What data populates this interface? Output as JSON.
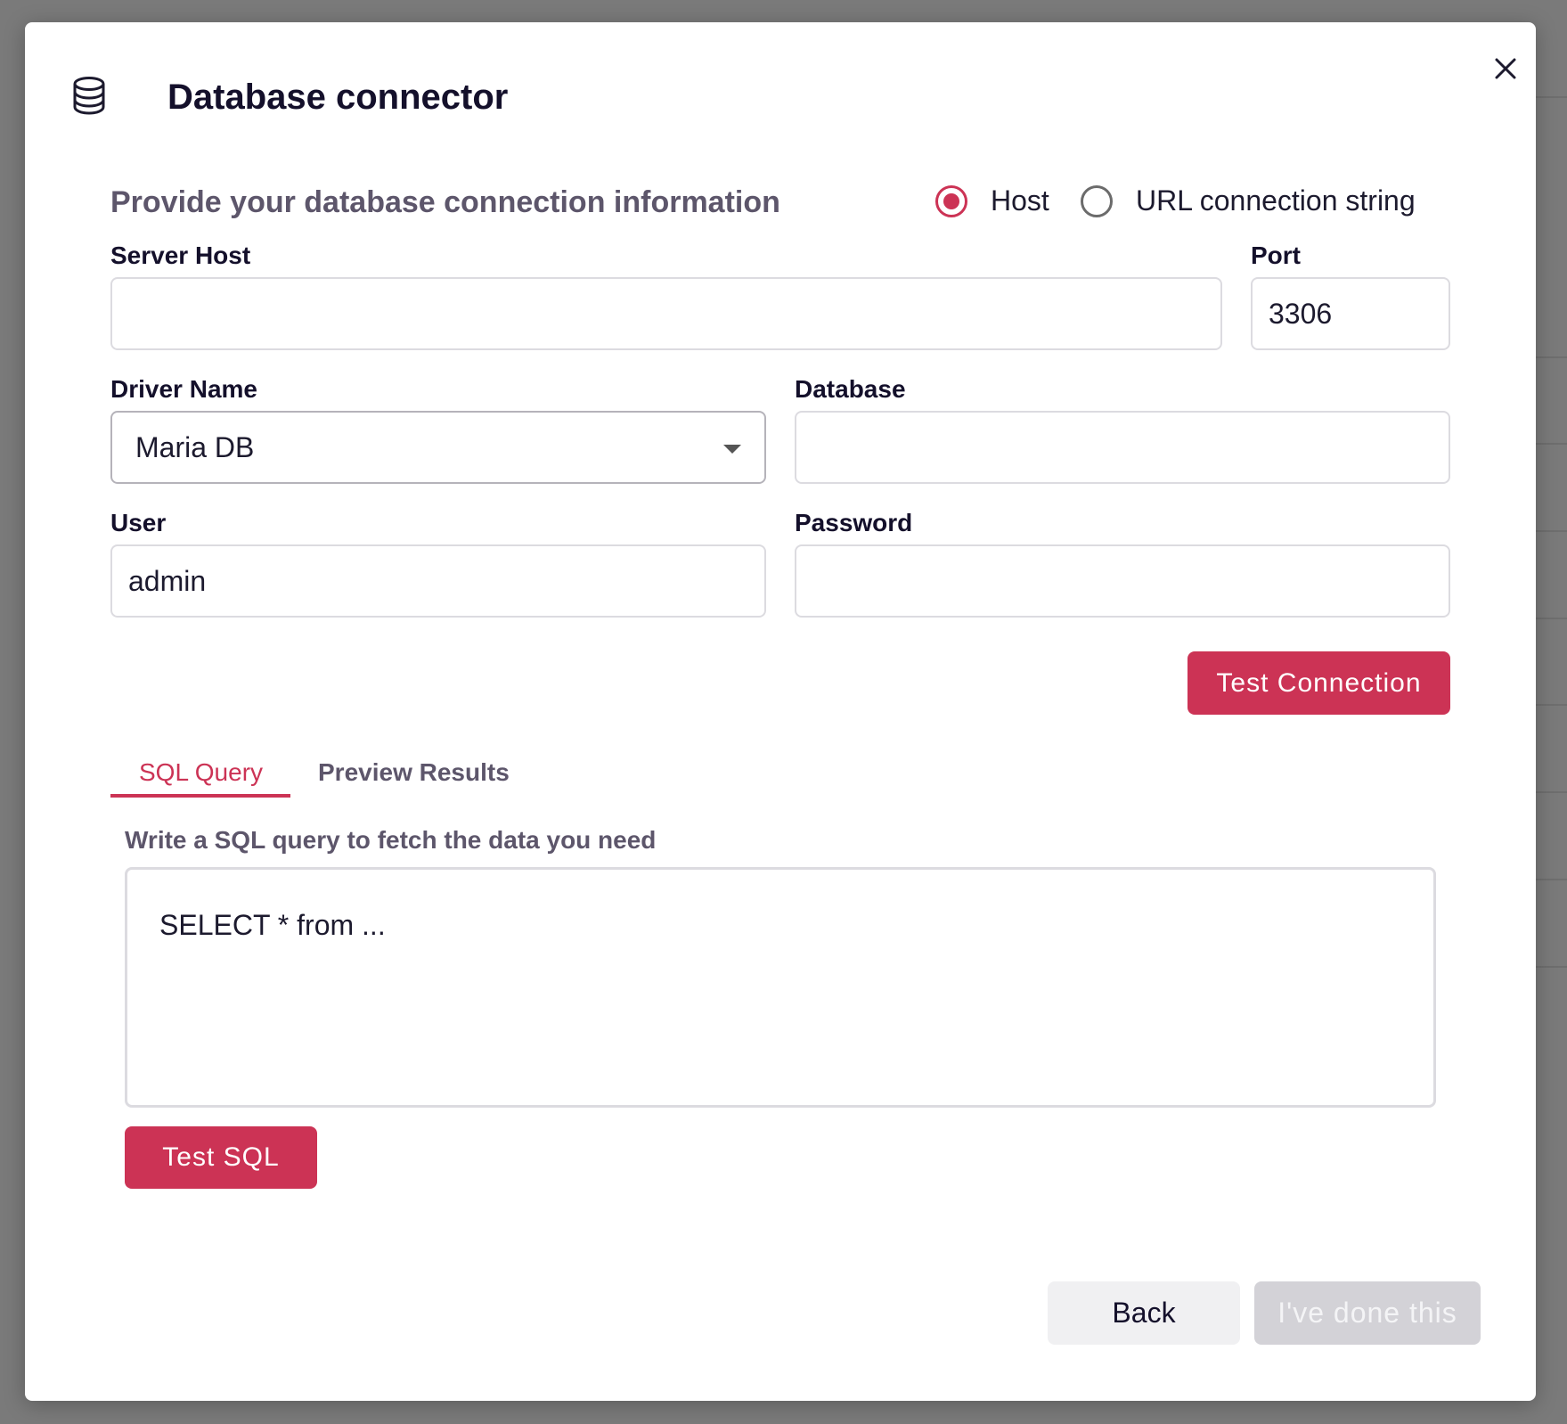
{
  "dialog": {
    "title": "Database connector",
    "icon": "database-icon",
    "close_icon": "close-icon"
  },
  "connection": {
    "subtitle": "Provide your database connection information",
    "mode_options": [
      {
        "label": "Host",
        "selected": true
      },
      {
        "label": "URL connection string",
        "selected": false
      }
    ],
    "fields": {
      "server_host": {
        "label": "Server Host",
        "value": ""
      },
      "port": {
        "label": "Port",
        "value": "3306"
      },
      "driver_name": {
        "label": "Driver Name",
        "value": "Maria DB"
      },
      "database": {
        "label": "Database",
        "value": ""
      },
      "user": {
        "label": "User",
        "value": "admin"
      },
      "password": {
        "label": "Password",
        "value": ""
      }
    },
    "test_connection_label": "Test Connection"
  },
  "tabs": [
    {
      "label": "SQL Query",
      "active": true
    },
    {
      "label": "Preview Results",
      "active": false
    }
  ],
  "sql": {
    "hint": "Write a SQL query to fetch the data you need",
    "query": "SELECT * from ...",
    "test_sql_label": "Test SQL"
  },
  "footer": {
    "back_label": "Back",
    "done_label": "I've done this",
    "done_enabled": false
  },
  "colors": {
    "accent": "#cc3355",
    "overlay": "#7a7a7a",
    "disabled": "#d3d2d7"
  }
}
